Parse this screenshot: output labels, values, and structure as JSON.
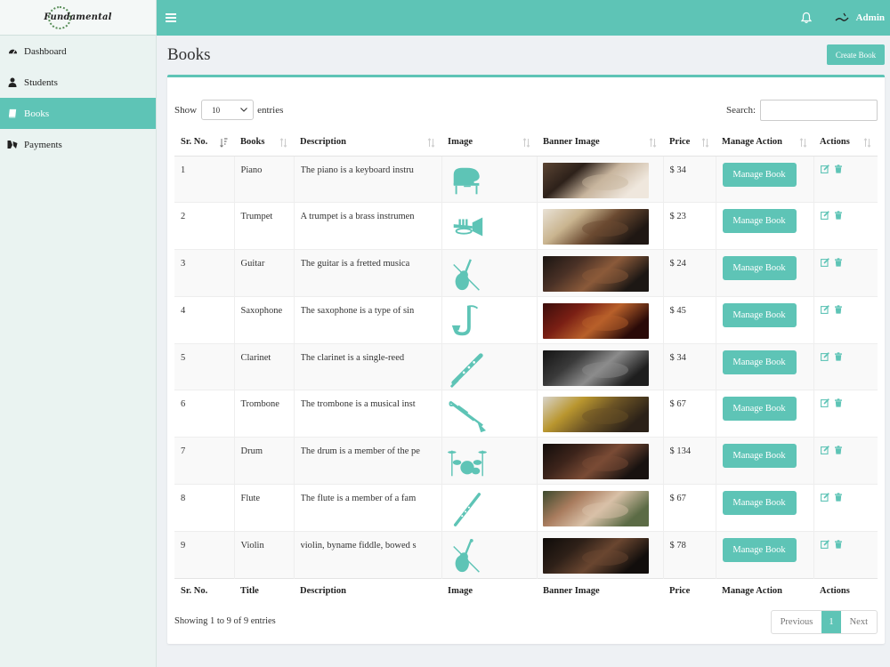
{
  "brand": {
    "logo_text": "Fundamental"
  },
  "sidebar": {
    "items": [
      {
        "label": "Dashboard",
        "icon": "dashboard-icon",
        "active": false
      },
      {
        "label": "Students",
        "icon": "user-icon",
        "active": false
      },
      {
        "label": "Books",
        "icon": "book-icon",
        "active": true
      },
      {
        "label": "Payments",
        "icon": "payments-icon",
        "active": false
      }
    ]
  },
  "topbar": {
    "user_name": "Admin"
  },
  "page": {
    "title": "Books",
    "create_label": "Create Book"
  },
  "controls": {
    "show_label": "Show",
    "entries_label": "entries",
    "page_length": "10",
    "search_label": "Search:",
    "search_value": ""
  },
  "table": {
    "headers": [
      "Sr. No.",
      "Books",
      "Description",
      "Image",
      "Banner Image",
      "Price",
      "Manage Action",
      "Actions"
    ],
    "footers": [
      "Sr. No.",
      "Title",
      "Description",
      "Image",
      "Banner Image",
      "Price",
      "Manage Action",
      "Actions"
    ],
    "manage_label": "Manage Book",
    "rows": [
      {
        "sr": "1",
        "book": "Piano",
        "description": "The piano is a keyboard instru",
        "icon": "piano",
        "price": "$ 34",
        "banner": [
          "#5a4433",
          "#2d211a",
          "#c8b59e",
          "#efe7dd"
        ]
      },
      {
        "sr": "2",
        "book": "Trumpet",
        "description": "A trumpet is a brass instrumen",
        "icon": "trumpet",
        "price": "$ 23",
        "banner": [
          "#e9e2d6",
          "#c9b48f",
          "#6b4a31",
          "#1f1713"
        ]
      },
      {
        "sr": "3",
        "book": "Guitar",
        "description": "The guitar is a fretted musica",
        "icon": "guitar",
        "price": "$ 24",
        "banner": [
          "#1a1512",
          "#4a3126",
          "#8b5a3a",
          "#1c1714"
        ]
      },
      {
        "sr": "4",
        "book": "Saxophone",
        "description": "The saxophone is a type of sin",
        "icon": "saxophone",
        "price": "$ 45",
        "banner": [
          "#3b0d0b",
          "#7a1f14",
          "#b8602a",
          "#2a0a08"
        ]
      },
      {
        "sr": "5",
        "book": "Clarinet",
        "description": "The clarinet is a single-reed",
        "icon": "clarinet",
        "price": "$ 34",
        "banner": [
          "#141414",
          "#3a3a3a",
          "#8c8c8c",
          "#1e1e1e"
        ]
      },
      {
        "sr": "6",
        "book": "Trombone",
        "description": "The trombone is a musical inst",
        "icon": "trombone",
        "price": "$ 67",
        "banner": [
          "#d8d4cc",
          "#b9962f",
          "#6b5325",
          "#2b2118"
        ]
      },
      {
        "sr": "7",
        "book": "Drum",
        "description": "The drum is a member of the pe",
        "icon": "drum",
        "price": "$ 134",
        "banner": [
          "#120d0b",
          "#3d241b",
          "#7a4b35",
          "#181210"
        ]
      },
      {
        "sr": "8",
        "book": "Flute",
        "description": "The flute is a member of a fam",
        "icon": "flute",
        "price": "$ 67",
        "banner": [
          "#3c4a2e",
          "#a97c5e",
          "#d9c1a8",
          "#5b6b45"
        ]
      },
      {
        "sr": "9",
        "book": "Violin",
        "description": "violin, byname fiddle, bowed s",
        "icon": "violin",
        "price": "$ 78",
        "banner": [
          "#0e0b09",
          "#2e2018",
          "#6a4630",
          "#120e0c"
        ]
      }
    ]
  },
  "footer": {
    "info": "Showing 1 to 9 of 9 entries",
    "prev_label": "Previous",
    "current_page": "1",
    "next_label": "Next"
  },
  "colors": {
    "accent": "#5ec4b6"
  }
}
